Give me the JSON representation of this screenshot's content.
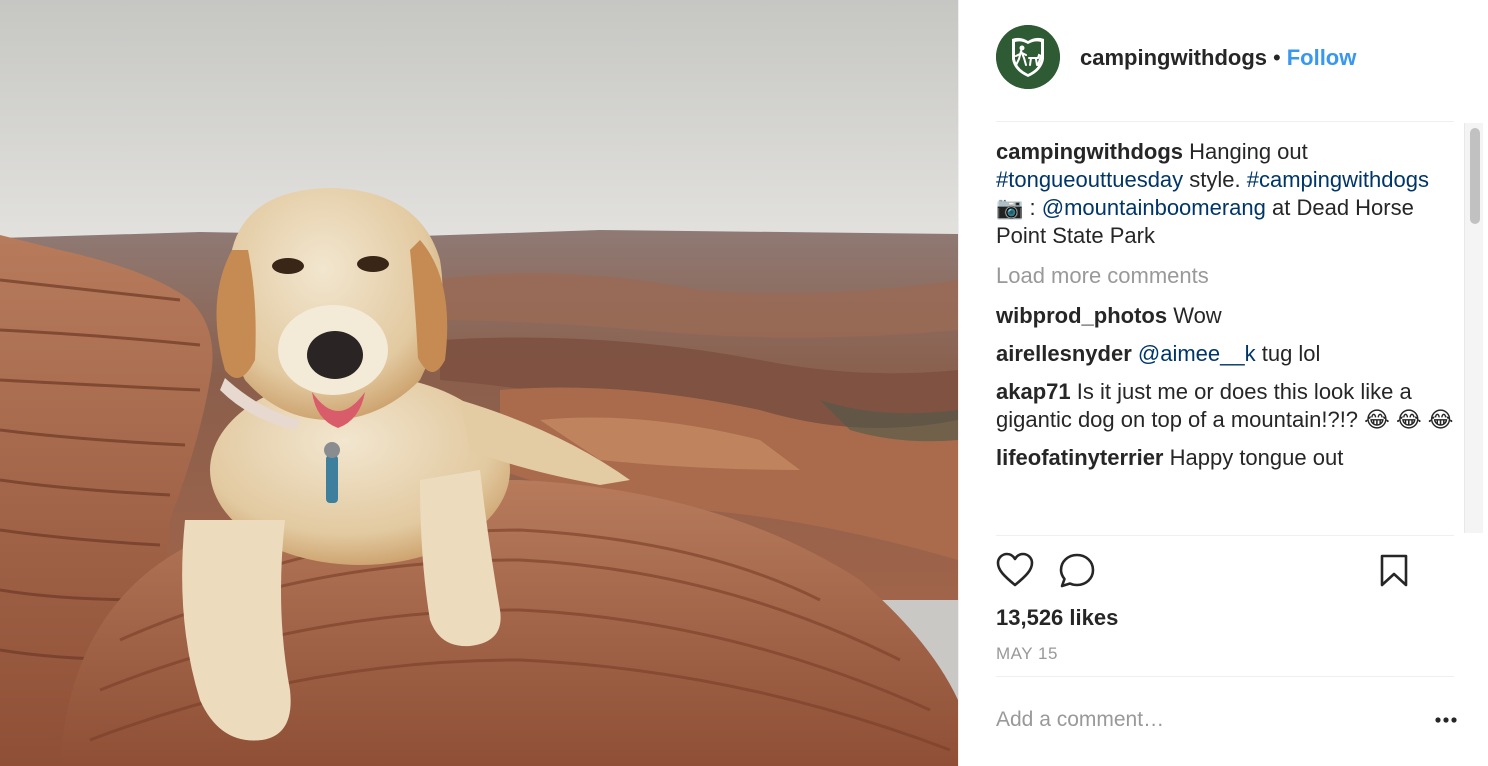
{
  "post": {
    "username": "campingwithdogs",
    "separator": "•",
    "follow_label": "Follow",
    "avatar_icon": "hiker-with-dog-shield-icon",
    "photo_alt": "golden retriever on red rock canyon",
    "caption": {
      "user": "campingwithdogs",
      "text_1": " Hanging out ",
      "hashtag_1": "#tongueouttuesday",
      "text_2": " style. ",
      "hashtag_2": "#campingwithdogs",
      "emoji": "📷",
      "text_3": " : ",
      "mention": "@mountainboomerang",
      "text_4": " at Dead Horse Point State Park"
    },
    "load_more_label": "Load more comments",
    "comments": [
      {
        "user": "wibprod_photos",
        "text": " Wow",
        "mention": "",
        "after": ""
      },
      {
        "user": "airellesnyder",
        "text": " ",
        "mention": "@aimee__k",
        "after": " tug lol"
      },
      {
        "user": "akap71",
        "text": " Is it just me or does this look like a gigantic dog on top of a mountain!?!? 😂 😂 😂",
        "mention": "",
        "after": ""
      },
      {
        "user": "lifeofatinyterrier",
        "text": " Happy tongue out",
        "mention": "",
        "after": ""
      }
    ],
    "likes_label": "13,526 likes",
    "date_label": "MAY 15",
    "add_comment_placeholder": "Add a comment…",
    "icons": {
      "like": "heart-icon",
      "comment": "comment-bubble-icon",
      "save": "bookmark-icon",
      "more": "more-options-icon"
    },
    "colors": {
      "link_blue": "#3897f0",
      "tag_blue": "#003569",
      "text": "#262626",
      "muted": "#999999",
      "avatar_green": "#2e5a34"
    }
  }
}
